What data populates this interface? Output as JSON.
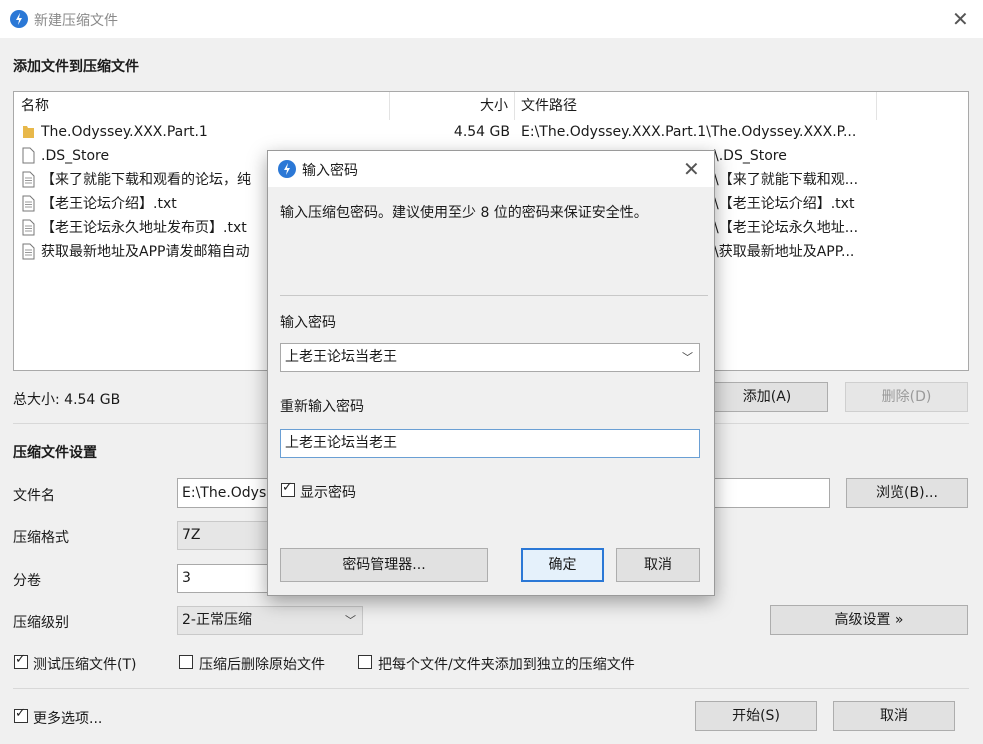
{
  "window": {
    "title": "新建压缩文件"
  },
  "section_add": {
    "heading": "添加文件到压缩文件"
  },
  "file_list": {
    "columns": [
      "名称",
      "大小",
      "文件路径"
    ],
    "rows": [
      {
        "type": "folder",
        "name": "The.Odyssey.XXX.Part.1",
        "size": "4.54 GB",
        "path": "E:\\The.Odyssey.XXX.Part.1\\The.Odyssey.XXX.P..."
      },
      {
        "type": "file",
        "name": ".DS_Store",
        "size": "",
        "path": "\\.DS_Store"
      },
      {
        "type": "file",
        "name": "【来了就能下载和观看的论坛，纯",
        "size": "",
        "path": "\\【来了就能下载和观..."
      },
      {
        "type": "file",
        "name": "【老王论坛介绍】.txt",
        "size": "",
        "path": "\\【老王论坛介绍】.txt"
      },
      {
        "type": "file",
        "name": "【老王论坛永久地址发布页】.txt",
        "size": "",
        "path": "\\【老王论坛永久地址..."
      },
      {
        "type": "file",
        "name": "获取最新地址及APP请发邮箱自动",
        "size": "",
        "path": "\\获取最新地址及APP..."
      }
    ]
  },
  "total_size": "总大小: 4.54 GB",
  "buttons": {
    "add": "添加(A)",
    "delete": "删除(D)",
    "browse": "浏览(B)...",
    "advanced": "高级设置 »",
    "start": "开始(S)",
    "cancel": "取消"
  },
  "section_settings": {
    "heading": "压缩文件设置"
  },
  "settings": {
    "filename_label": "文件名",
    "filename_value": "E:\\The.Odys",
    "format_label": "压缩格式",
    "format_value": "7Z",
    "split_label": "分卷",
    "split_value": "3",
    "level_label": "压缩级别",
    "level_value": "2-正常压缩"
  },
  "options": {
    "test": {
      "label": "测试压缩文件(T)",
      "checked": true
    },
    "delete_after": {
      "label": "压缩后删除原始文件",
      "checked": false
    },
    "each_separate": {
      "label": "把每个文件/文件夹添加到独立的压缩文件",
      "checked": false
    },
    "more": {
      "label": "更多选项...",
      "checked": true
    }
  },
  "dialog": {
    "title": "输入密码",
    "message": "输入压缩包密码。建议使用至少 8 位的密码来保证安全性。",
    "password_label": "输入密码",
    "password_value": "上老王论坛当老王",
    "reenter_label": "重新输入密码",
    "reenter_value": "上老王论坛当老王",
    "show_password": {
      "label": "显示密码",
      "checked": true
    },
    "manager_button": "密码管理器...",
    "ok_button": "确定",
    "cancel_button": "取消"
  },
  "colors": {
    "accent": "#2b78d6",
    "folder": "#e8b84a"
  }
}
